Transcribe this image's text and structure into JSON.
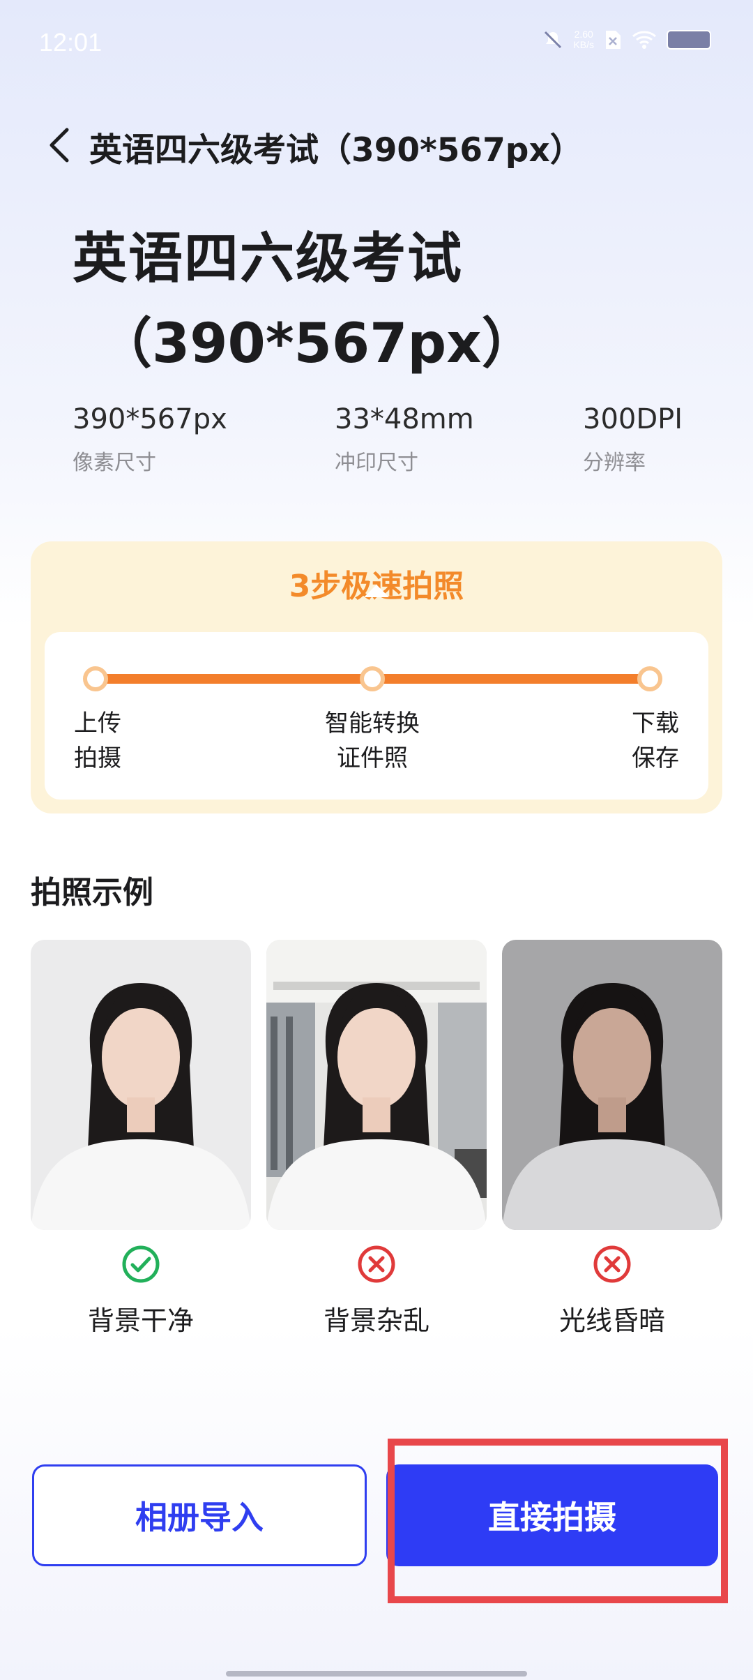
{
  "status_bar": {
    "time": "12:01",
    "network_speed_value": "2.60",
    "network_speed_unit": "KB/s"
  },
  "header": {
    "title": "英语四六级考试（390*567px）"
  },
  "hero": {
    "title_line1": "英语四六级考试",
    "title_line2": "（390*567px）"
  },
  "specs": [
    {
      "value": "390*567px",
      "label": "像素尺寸"
    },
    {
      "value": "33*48mm",
      "label": "冲印尺寸"
    },
    {
      "value": "300DPI",
      "label": "分辨率"
    }
  ],
  "steps": {
    "title": "3步极速拍照",
    "items": [
      {
        "line1": "上传",
        "line2": "拍摄"
      },
      {
        "line1": "智能转换",
        "line2": "证件照"
      },
      {
        "line1": "下载",
        "line2": "保存"
      }
    ]
  },
  "examples": {
    "title": "拍照示例",
    "items": [
      {
        "label": "背景干净",
        "status": "ok"
      },
      {
        "label": "背景杂乱",
        "status": "bad"
      },
      {
        "label": "光线昏暗",
        "status": "bad"
      }
    ]
  },
  "buttons": {
    "album": "相册导入",
    "shoot": "直接拍摄"
  },
  "colors": {
    "accent_blue": "#2e3cf5",
    "accent_orange": "#f37e2b",
    "ok_green": "#22b05a",
    "bad_red": "#e03a3a",
    "highlight_red": "#e8474b"
  }
}
